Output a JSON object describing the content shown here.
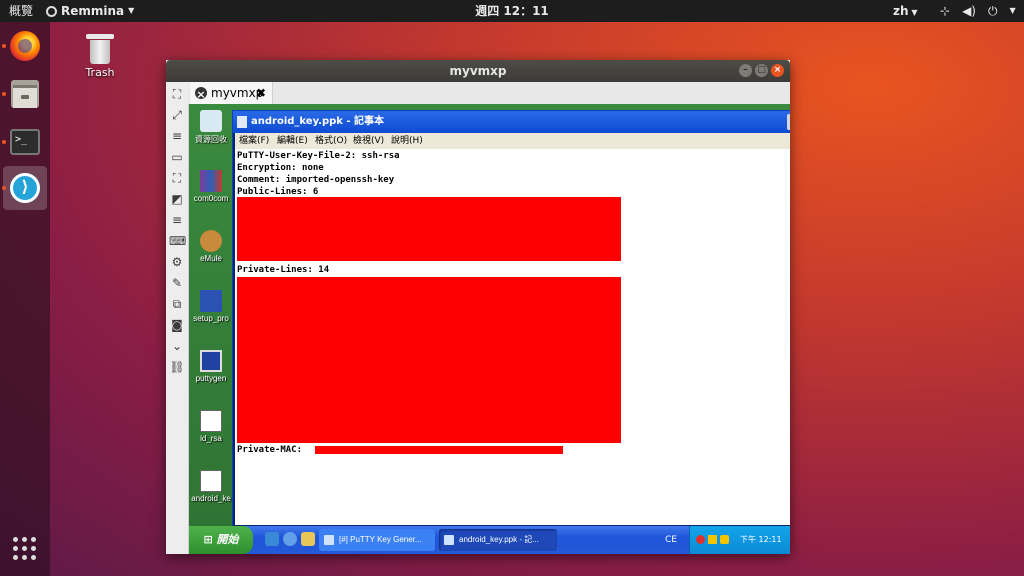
{
  "topbar": {
    "activities": "概覽",
    "app_name": "Remmina",
    "app_menu_icon": "chevron-down-icon",
    "clock": "週四 12：11",
    "input_method": "zh",
    "system_icons": [
      "network-icon",
      "volume-icon",
      "power-icon"
    ]
  },
  "dock": {
    "items": [
      "firefox",
      "files",
      "terminal",
      "remmina"
    ],
    "running_indicator_color": "#e95420"
  },
  "desktop": {
    "trash_label": "Trash"
  },
  "remmina": {
    "window_title": "myvmxp",
    "tab_label": "myvmxp",
    "tab_close": "✖"
  },
  "xp": {
    "desktop_icons": [
      "資源回收",
      "com0com",
      "eMule",
      "setup_pro",
      "puttygen",
      "id_rsa",
      "android_ke"
    ],
    "notepad": {
      "title": "android_key.ppk - 記事本",
      "menu": [
        "檔案(F)",
        "編輯(E)",
        "格式(O)",
        "檢視(V)",
        "說明(H)"
      ],
      "lines": [
        "PuTTY-User-Key-File-2: ssh-rsa",
        "Encryption: none",
        "Comment: imported-openssh-key",
        "Public-Lines: 6",
        "Private-Lines: 14",
        "Private-MAC: "
      ]
    },
    "taskbar": {
      "start_label": "開始",
      "buttons": [
        "[#] PuTTY Key Gener...",
        "android_key.ppk - 記..."
      ],
      "lang": "CE",
      "clock": "下午 12:11"
    }
  },
  "colors": {
    "accent": "#e95420",
    "redaction": "#ff0000",
    "xp_title_blue": "#0e4bd2",
    "xp_start_green": "#2f8f2d"
  }
}
